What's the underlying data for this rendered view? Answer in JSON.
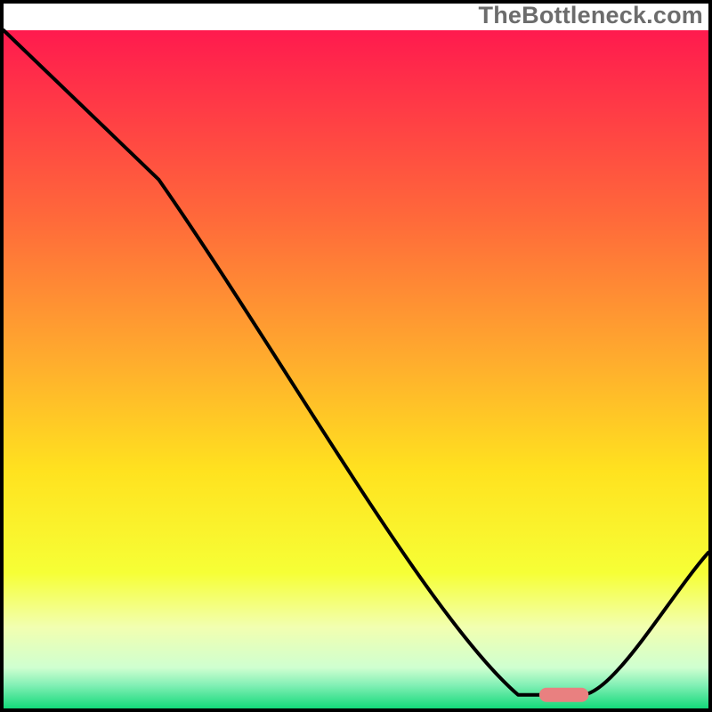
{
  "watermark": "TheBottleneck.com",
  "chart_data": {
    "type": "line",
    "title": "",
    "xlabel": "",
    "ylabel": "",
    "xlim": [
      0,
      100
    ],
    "ylim": [
      0,
      100
    ],
    "grid": false,
    "legend": false,
    "background_gradient": {
      "stops": [
        {
          "offset": 0.0,
          "color": "#ff1a4e"
        },
        {
          "offset": 0.28,
          "color": "#ff6a3a"
        },
        {
          "offset": 0.48,
          "color": "#ffaa2e"
        },
        {
          "offset": 0.65,
          "color": "#ffe21f"
        },
        {
          "offset": 0.8,
          "color": "#f6ff36"
        },
        {
          "offset": 0.88,
          "color": "#f2ffb0"
        },
        {
          "offset": 0.94,
          "color": "#cfffd0"
        },
        {
          "offset": 0.965,
          "color": "#84f0b6"
        },
        {
          "offset": 1.0,
          "color": "#14d97a"
        }
      ]
    },
    "curve": {
      "comment": "Approximate bottleneck curve: high at left, descends, flat minimum around x≈76-82, rises again to right edge.",
      "x": [
        0,
        22,
        73,
        82,
        100
      ],
      "y": [
        100,
        78,
        2,
        2,
        23
      ]
    },
    "marker": {
      "comment": "Rounded red bar at the curve minimum",
      "x_start": 76,
      "x_end": 83,
      "y": 2,
      "color": "#e98080"
    },
    "frame": {
      "border_color": "#000000",
      "border_width": 4
    }
  }
}
